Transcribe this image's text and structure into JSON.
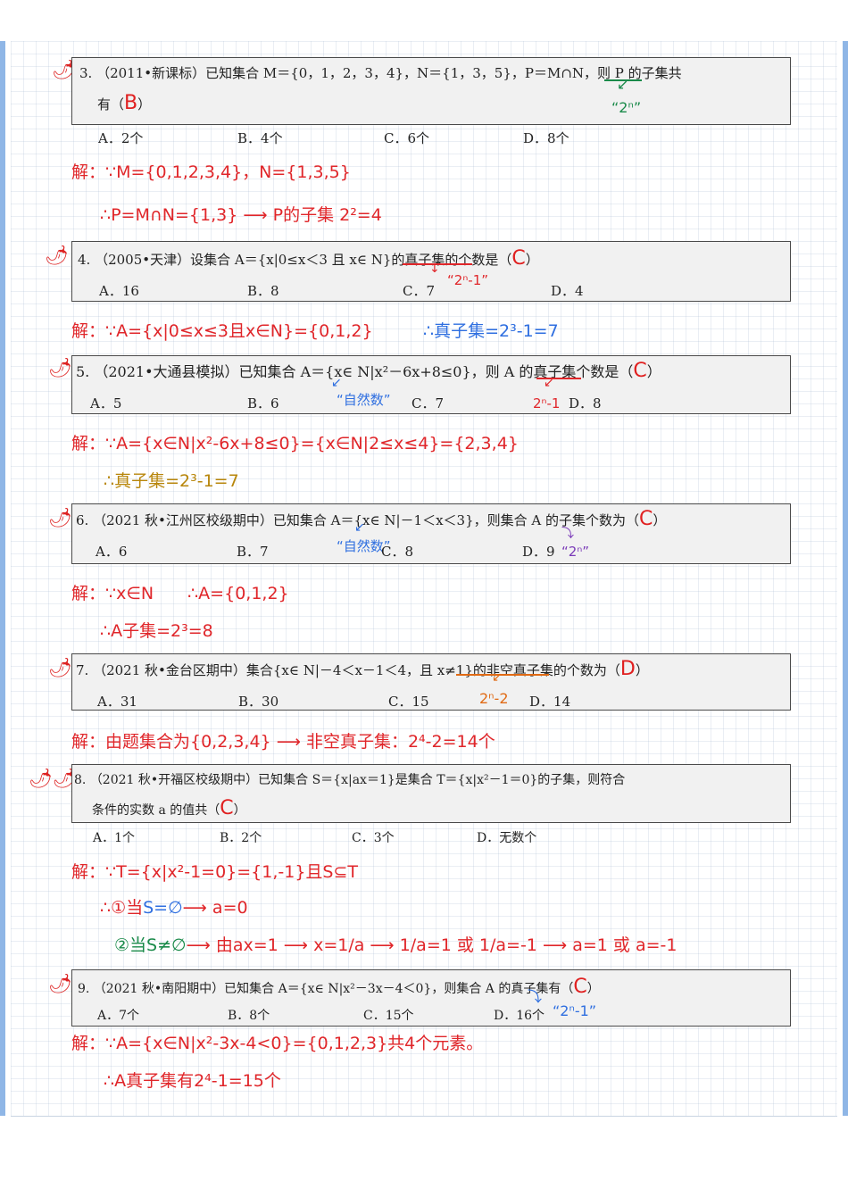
{
  "q3": {
    "stem1": "3. （2011•新课标）已知集合 M＝{0，1，2，3，4}，N＝{1，3，5}，P＝M∩N，则 P 的子集共",
    "stem2": "有（",
    "answer": "B",
    "stem2_end": "）",
    "note": "“2ⁿ”",
    "options": [
      "A．2个",
      "B．4个",
      "C．6个",
      "D．8个"
    ],
    "sol1": "解：∵M={0,1,2,3,4}，N={1,3,5}",
    "sol2": "∴P=M∩N={1,3} ⟶ P的子集 2²=4"
  },
  "q4": {
    "stem": "4. （2005•天津）设集合 A＝{x|0≤x＜3 且 x∈ N}的真子集的个数是（",
    "answer": "C",
    "stem_end": "）",
    "note": "“2ⁿ-1”",
    "options": [
      "A．16",
      "B．8",
      "C．7",
      "D．4"
    ],
    "sol_red": "解：∵A={x|0≤x≤3且x∈N}={0,1,2}",
    "sol_blue": "∴真子集=2³-1=7"
  },
  "q5": {
    "stem": "5. （2021•大通县模拟）已知集合 A＝{x∈ N|x²－6x+8≤0}，则 A 的真子集个数是（",
    "answer": "C",
    "stem_end": "）",
    "note_natural": "“自然数”",
    "note_formula": "2ⁿ-1",
    "options": [
      "A．5",
      "B．6",
      "C．7",
      "D．8"
    ],
    "sol1": "解：∵A={x∈N|x²-6x+8≤0}={x∈N|2≤x≤4}={2,3,4}",
    "sol2": "∴真子集=2³-1=7"
  },
  "q6": {
    "stem": "6. （2021 秋•江州区校级期中）已知集合 A＝{x∈ N|－1＜x＜3}，则集合 A 的子集个数为（",
    "answer": "C",
    "stem_end": "）",
    "note_natural": "“自然数”",
    "note_formula": "“2ⁿ”",
    "options": [
      "A．6",
      "B．7",
      "C．8",
      "D．9"
    ],
    "sol1": "解：∵x∈N　　∴A={0,1,2}",
    "sol2": "∴A子集=2³=8"
  },
  "q7": {
    "stem": "7. （2021 秋•金台区期中）集合{x∈ N|－4＜x－1＜4，且 x≠1}的非空真子集的个数为（",
    "answer": "D",
    "stem_end": "）",
    "note_formula": "2ⁿ-2",
    "options": [
      "A．31",
      "B．30",
      "C．15",
      "D．14"
    ],
    "sol1": "解：由题集合为{0,2,3,4} ⟶ 非空真子集：2⁴-2=14个"
  },
  "q8": {
    "stem1": "8. （2021 秋•开福区校级期中）已知集合 S＝{x|ax＝1}是集合 T＝{x|x²－1＝0}的子集，则符合",
    "stem2": "条件的实数 a 的值共（",
    "answer": "C",
    "stem2_end": "）",
    "options": [
      "A．1个",
      "B．2个",
      "C．3个",
      "D．无数个"
    ],
    "sol1": "解：∵T={x|x²-1=0}={1,-1}且S⊆T",
    "sol2_prefix": "∴①当",
    "sol2_mid": "S=∅",
    "sol2_rest": "⟶ a=0",
    "sol3_mid": "②当S≠∅",
    "sol3_rest": "⟶ 由ax=1 ⟶ x=1/a ⟶ 1/a=1 或 1/a=-1 ⟶ a=1 或 a=-1"
  },
  "q9": {
    "stem": "9. （2021 秋•南阳期中）已知集合 A＝{x∈ N|x²－3x－4＜0}，则集合 A 的真子集有（",
    "answer": "C",
    "stem_end": "）",
    "note_formula": "“2ⁿ-1”",
    "options": [
      "A．7个",
      "B．8个",
      "C．15个",
      "D．16个"
    ],
    "sol1": "解：∵A={x∈N|x²-3x-4<0}={0,1,2,3}共4个元素。",
    "sol2": "∴A真子集有2⁴-1=15个"
  }
}
